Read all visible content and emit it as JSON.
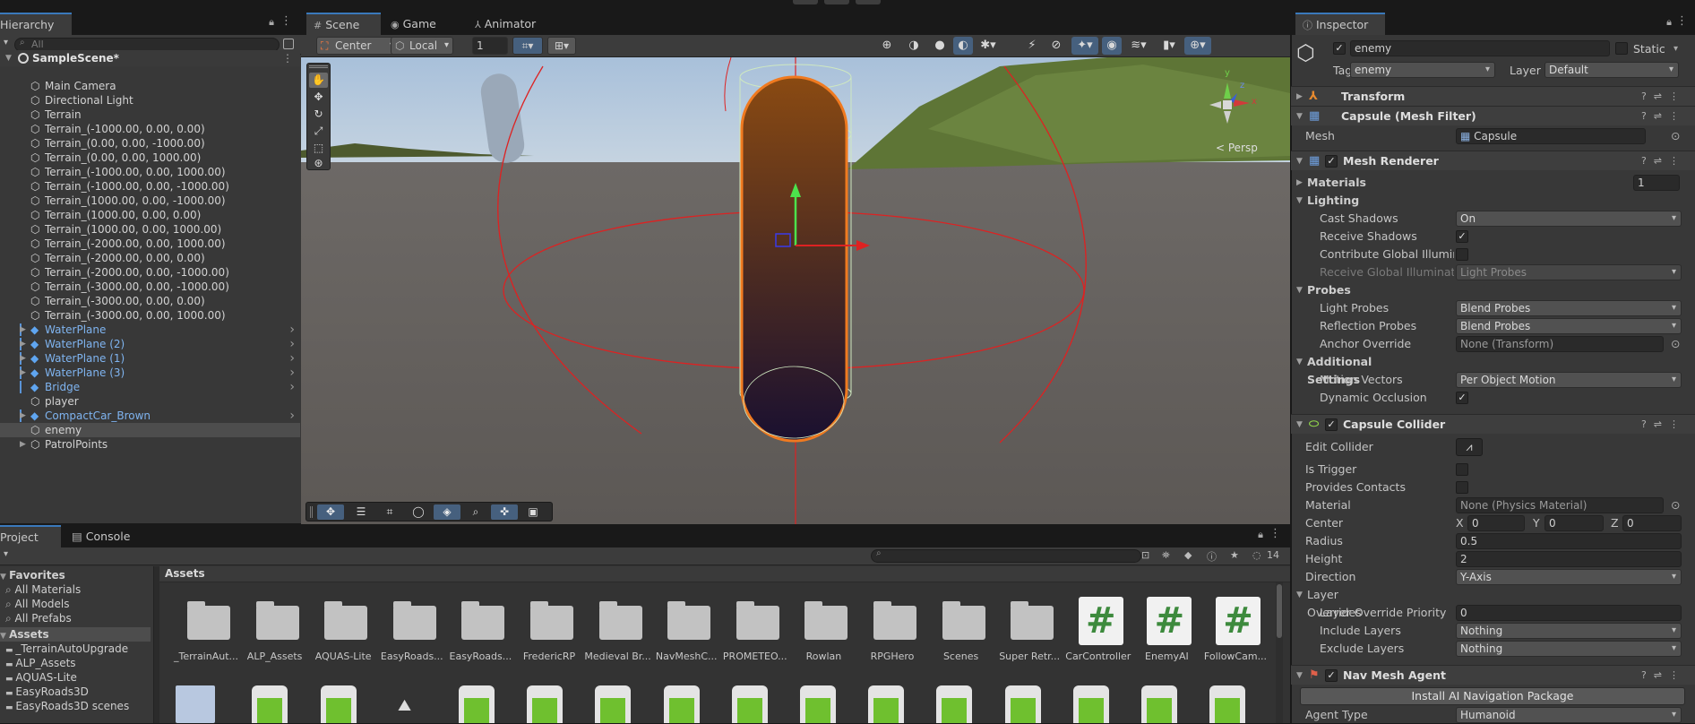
{
  "hierarchy": {
    "tab_label": "Hierarchy",
    "search_placeholder": "All",
    "scene_name": "SampleScene*",
    "items": [
      {
        "label": "Main Camera"
      },
      {
        "label": "Directional Light"
      },
      {
        "label": "Terrain"
      },
      {
        "label": "Terrain_(-1000.00, 0.00, 0.00)"
      },
      {
        "label": "Terrain_(0.00, 0.00, -1000.00)"
      },
      {
        "label": "Terrain_(0.00, 0.00, 1000.00)"
      },
      {
        "label": "Terrain_(-1000.00, 0.00, 1000.00)"
      },
      {
        "label": "Terrain_(-1000.00, 0.00, -1000.00)"
      },
      {
        "label": "Terrain_(1000.00, 0.00, -1000.00)"
      },
      {
        "label": "Terrain_(1000.00, 0.00, 0.00)"
      },
      {
        "label": "Terrain_(1000.00, 0.00, 1000.00)"
      },
      {
        "label": "Terrain_(-2000.00, 0.00, 1000.00)"
      },
      {
        "label": "Terrain_(-2000.00, 0.00, 0.00)"
      },
      {
        "label": "Terrain_(-2000.00, 0.00, -1000.00)"
      },
      {
        "label": "Terrain_(-3000.00, 0.00, -1000.00)"
      },
      {
        "label": "Terrain_(-3000.00, 0.00, 0.00)"
      },
      {
        "label": "Terrain_(-3000.00, 0.00, 1000.00)"
      },
      {
        "label": "WaterPlane"
      },
      {
        "label": "WaterPlane (2)"
      },
      {
        "label": "WaterPlane (1)"
      },
      {
        "label": "WaterPlane (3)"
      },
      {
        "label": "Bridge"
      },
      {
        "label": "player"
      },
      {
        "label": "CompactCar_Brown"
      },
      {
        "label": "enemy"
      },
      {
        "label": "PatrolPoints"
      }
    ]
  },
  "scene_tabs": {
    "scene": "Scene",
    "game": "Game",
    "animator": "Animator"
  },
  "scene_toolbar": {
    "pivot": "Center",
    "space": "Local",
    "grid_value": "1"
  },
  "scene_view": {
    "persp_label": "< Persp",
    "gizmo_x": "x",
    "gizmo_y": "y",
    "gizmo_z": "z"
  },
  "project": {
    "tab_project": "Project",
    "tab_console": "Console",
    "favorites_label": "Favorites",
    "favorites": [
      "All Materials",
      "All Models",
      "All Prefabs"
    ],
    "assets_root": "Assets",
    "asset_folders": [
      "_TerrainAutoUpgrade",
      "ALP_Assets",
      "AQUAS-Lite",
      "EasyRoads3D",
      "EasyRoads3D scenes"
    ],
    "breadcrumb": "Assets",
    "hidden_count": "14",
    "grid_items": [
      {
        "name": "_TerrainAut...",
        "kind": "folder"
      },
      {
        "name": "ALP_Assets",
        "kind": "folder"
      },
      {
        "name": "AQUAS-Lite",
        "kind": "folder"
      },
      {
        "name": "EasyRoads...",
        "kind": "folder"
      },
      {
        "name": "EasyRoads...",
        "kind": "folder"
      },
      {
        "name": "FredericRP",
        "kind": "folder"
      },
      {
        "name": "Medieval Br...",
        "kind": "folder"
      },
      {
        "name": "NavMeshC...",
        "kind": "folder"
      },
      {
        "name": "PROMETEO...",
        "kind": "folder"
      },
      {
        "name": "Rowlan",
        "kind": "folder"
      },
      {
        "name": "RPGHero",
        "kind": "folder"
      },
      {
        "name": "Scenes",
        "kind": "folder"
      },
      {
        "name": "Super Retr...",
        "kind": "folder"
      },
      {
        "name": "CarController",
        "kind": "script"
      },
      {
        "name": "EnemyAI",
        "kind": "script"
      },
      {
        "name": "FollowCam...",
        "kind": "script"
      }
    ]
  },
  "inspector": {
    "tab_label": "Inspector",
    "object_name": "enemy",
    "static_label": "Static",
    "tag_label": "Tag",
    "tag_value": "enemy",
    "layer_label": "Layer",
    "layer_value": "Default",
    "transform": "Transform",
    "mesh_filter": "Capsule (Mesh Filter)",
    "mesh_label": "Mesh",
    "mesh_value": "Capsule",
    "mesh_renderer": "Mesh Renderer",
    "materials_label": "Materials",
    "materials_count": "1",
    "lighting_label": "Lighting",
    "cast_shadows_label": "Cast Shadows",
    "cast_shadows_value": "On",
    "receive_shadows_label": "Receive Shadows",
    "contribute_gi_label": "Contribute Global Illuminat",
    "receive_gi_label": "Receive Global Illuminatior",
    "receive_gi_value": "Light Probes",
    "probes_label": "Probes",
    "light_probes_label": "Light Probes",
    "light_probes_value": "Blend Probes",
    "reflection_probes_label": "Reflection Probes",
    "reflection_probes_value": "Blend Probes",
    "anchor_override_label": "Anchor Override",
    "anchor_override_value": "None (Transform)",
    "additional_settings_label": "Additional Settings",
    "motion_vectors_label": "Motion Vectors",
    "motion_vectors_value": "Per Object Motion",
    "dynamic_occlusion_label": "Dynamic Occlusion",
    "capsule_collider": "Capsule Collider",
    "edit_collider_label": "Edit Collider",
    "is_trigger_label": "Is Trigger",
    "provides_contacts_label": "Provides Contacts",
    "material_label": "Material",
    "material_value": "None (Physics Material)",
    "center_label": "Center",
    "center_x_label": "X",
    "center_x": "0",
    "center_y_label": "Y",
    "center_y": "0",
    "center_z_label": "Z",
    "center_z": "0",
    "radius_label": "Radius",
    "radius_value": "0.5",
    "height_label": "Height",
    "height_value": "2",
    "direction_label": "Direction",
    "direction_value": "Y-Axis",
    "layer_overrides_label": "Layer Overrides",
    "layer_override_priority_label": "Layer Override Priority",
    "layer_override_priority_value": "0",
    "include_layers_label": "Include Layers",
    "include_layers_value": "Nothing",
    "exclude_layers_label": "Exclude Layers",
    "exclude_layers_value": "Nothing",
    "nav_mesh_agent": "Nav Mesh Agent",
    "install_button": "Install AI Navigation Package",
    "agent_type_label": "Agent Type",
    "agent_type_value": "Humanoid"
  },
  "colors": {
    "accent": "#3a79bb",
    "prefab_blue": "#7fb4f0",
    "selection": "#4d4d4d",
    "collider": "#e02020"
  }
}
